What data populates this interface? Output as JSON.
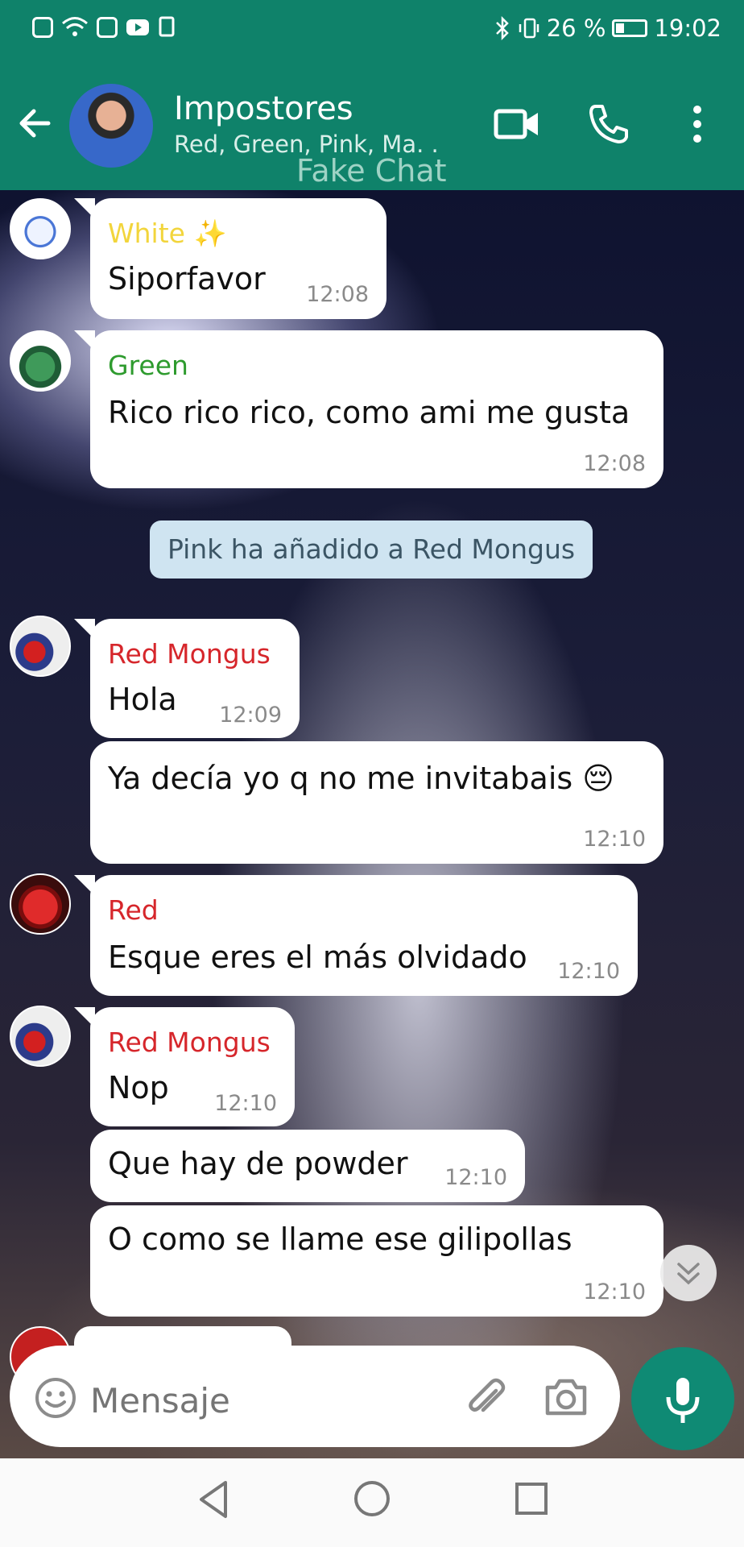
{
  "status_bar": {
    "battery": "26 %",
    "time": "19:02"
  },
  "header": {
    "title": "Impostores",
    "subtitle": "Red, Green, Pink, Ma. .",
    "watermark": "Fake Chat"
  },
  "messages": [
    {
      "sender": "White ✨",
      "sender_color": "#f2d53c",
      "text": "Siporfavor",
      "time": "12:08"
    },
    {
      "sender": "Green",
      "sender_color": "#2e9b2e",
      "text": "Rico rico rico, como ami me gusta",
      "time": "12:08"
    },
    {
      "system": "Pink ha añadido a Red Mongus"
    },
    {
      "sender": "Red Mongus",
      "sender_color": "#d6262b",
      "text": "Hola",
      "time": "12:09"
    },
    {
      "text": "Ya decía yo q no me invitabais 😔",
      "time": "12:10"
    },
    {
      "sender": "Red",
      "sender_color": "#d6262b",
      "text": "Esque eres el más olvidado",
      "time": "12:10"
    },
    {
      "sender": "Red Mongus",
      "sender_color": "#d6262b",
      "text": "Nop",
      "time": "12:10"
    },
    {
      "text": "Que hay de powder",
      "time": "12:10"
    },
    {
      "text": "O como se llame ese gilipollas",
      "time": "12:10"
    }
  ],
  "input": {
    "placeholder": "Mensaje"
  },
  "icons": {
    "back": "arrow-left-icon",
    "video": "video-call-icon",
    "call": "phone-icon",
    "menu": "more-vert-icon",
    "emoji": "emoji-icon",
    "attach": "paperclip-icon",
    "camera": "camera-icon",
    "mic": "microphone-icon",
    "scroll": "double-chevron-down-icon"
  },
  "colors": {
    "header": "#0f826a",
    "accent": "#0f8a74",
    "bubble": "#ffffff",
    "system_bubble": "#cfe4f1"
  }
}
